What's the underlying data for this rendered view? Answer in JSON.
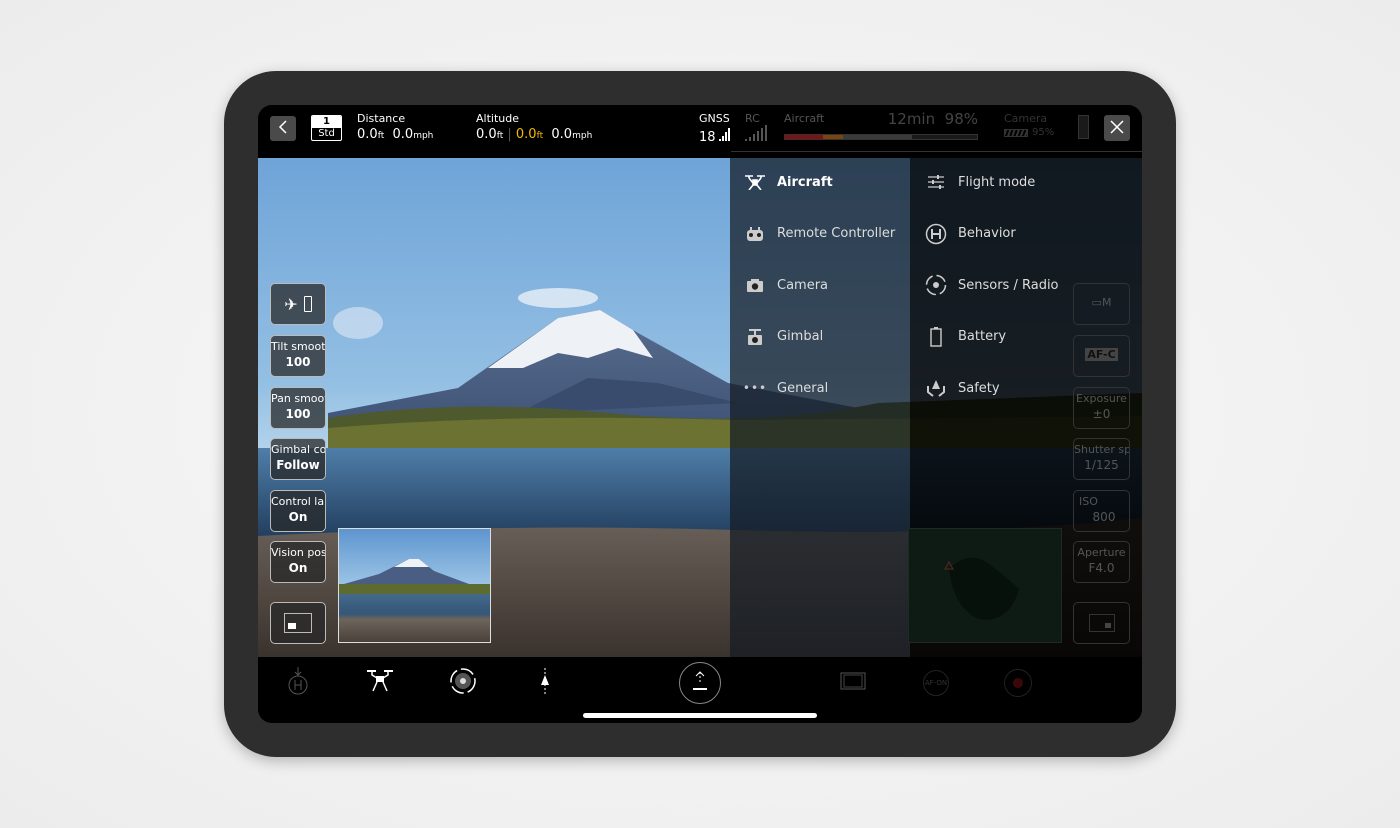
{
  "topbar": {
    "mode_number": "1",
    "mode_label": "Std",
    "distance": {
      "label": "Distance",
      "dist_value": "0.0",
      "dist_unit": "ft",
      "speed_value": "0.0",
      "speed_unit": "mph"
    },
    "altitude": {
      "label": "Altitude",
      "alt_value": "0.0",
      "alt_unit": "ft",
      "alt2_value": "0.0",
      "alt2_unit": "ft",
      "speed_value": "0.0",
      "speed_unit": "mph"
    },
    "gnss": {
      "label": "GNSS",
      "value": "18"
    },
    "rc": {
      "label": "RC"
    },
    "aircraft": {
      "label": "Aircraft",
      "time": "12min",
      "percent": "98%",
      "battery_level": 0.66
    },
    "camera": {
      "label": "Camera",
      "percent": "95%"
    }
  },
  "left_controls": [
    {
      "label": "Tilt smooth",
      "value": "100"
    },
    {
      "label": "Pan smooth",
      "value": "100"
    },
    {
      "label": "Gimbal control",
      "value": "Follow"
    },
    {
      "label": "Control lamp",
      "value": "On"
    },
    {
      "label": "Vision position",
      "value": "On"
    }
  ],
  "right_controls": [
    {
      "label": "",
      "value": "M"
    },
    {
      "label": "",
      "value": "AF-C"
    },
    {
      "label": "Exposure",
      "value": "±0"
    },
    {
      "label": "Shutter speed",
      "value": "1/125"
    },
    {
      "label": "ISO",
      "value": "800"
    },
    {
      "label": "Aperture",
      "value": "F4.0"
    }
  ],
  "menu": {
    "categories": [
      {
        "label": "Aircraft",
        "icon": "drone-icon",
        "selected": true
      },
      {
        "label": "Remote Controller",
        "icon": "remote-controller-icon"
      },
      {
        "label": "Camera",
        "icon": "camera-icon"
      },
      {
        "label": "Gimbal",
        "icon": "gimbal-icon"
      },
      {
        "label": "General",
        "icon": "more-icon"
      }
    ],
    "subitems": [
      {
        "label": "Flight mode",
        "icon": "sliders-icon"
      },
      {
        "label": "Behavior",
        "icon": "helipad-icon"
      },
      {
        "label": "Sensors / Radio",
        "icon": "sensor-icon"
      },
      {
        "label": "Battery",
        "icon": "battery-icon"
      },
      {
        "label": "Safety",
        "icon": "safety-icon"
      }
    ]
  },
  "bottombar": {
    "af_on_label": "AF-ON"
  },
  "colors": {
    "altitude_highlight": "#f5b800",
    "battery_red": "#8b1a1a",
    "battery_orange": "#8a4a12"
  }
}
